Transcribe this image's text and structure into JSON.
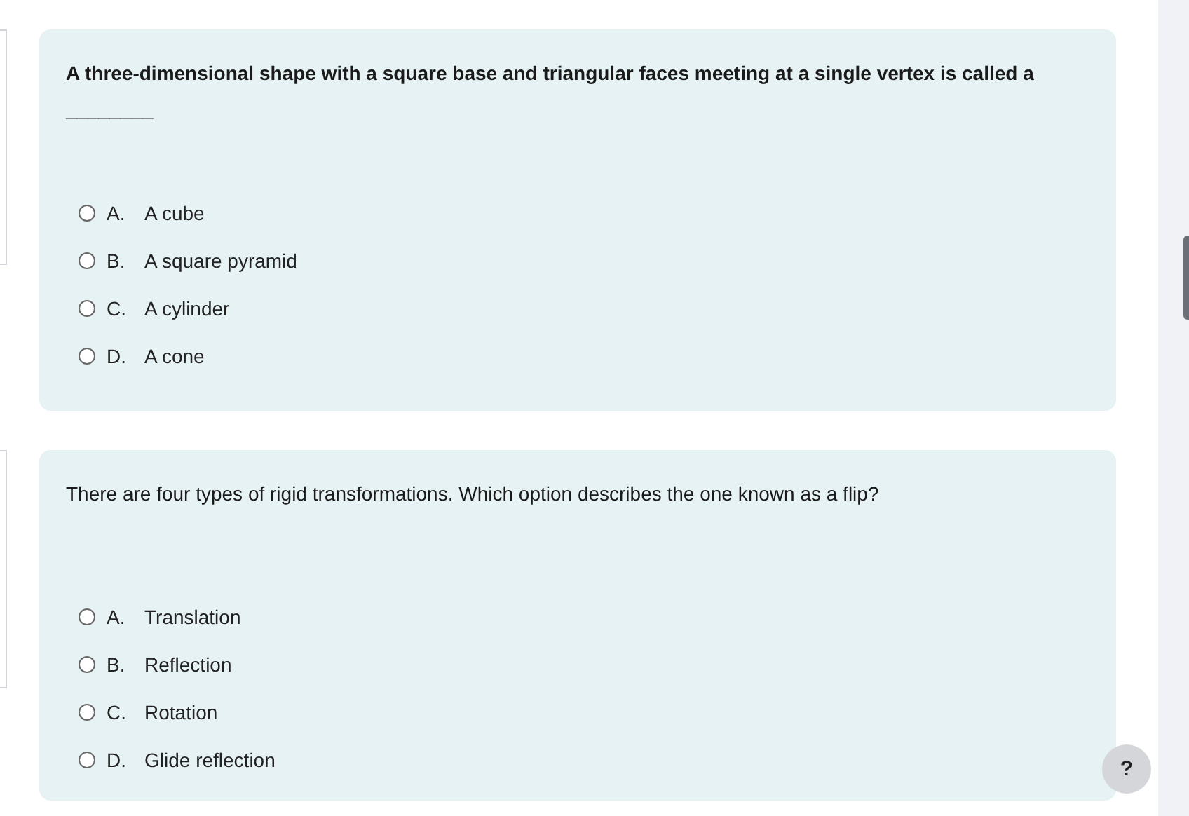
{
  "questions": [
    {
      "text": "A three-dimensional shape with a square base and triangular faces meeting at a single vertex is called a",
      "bold": true,
      "blank": "________",
      "options": [
        {
          "letter": "A.",
          "label": "A cube",
          "selected": false
        },
        {
          "letter": "B.",
          "label": "A square pyramid",
          "selected": false
        },
        {
          "letter": "C.",
          "label": "A cylinder",
          "selected": false
        },
        {
          "letter": "D.",
          "label": "A cone",
          "selected": false
        }
      ]
    },
    {
      "text": "There are four types of rigid transformations. Which option describes the one known as a flip?",
      "bold": false,
      "options": [
        {
          "letter": "A.",
          "label": "Translation",
          "selected": false
        },
        {
          "letter": "B.",
          "label": "Reflection",
          "selected": false
        },
        {
          "letter": "C.",
          "label": "Rotation",
          "selected": false
        },
        {
          "letter": "D.",
          "label": "Glide reflection",
          "selected": false
        }
      ]
    }
  ],
  "help_button": "?"
}
